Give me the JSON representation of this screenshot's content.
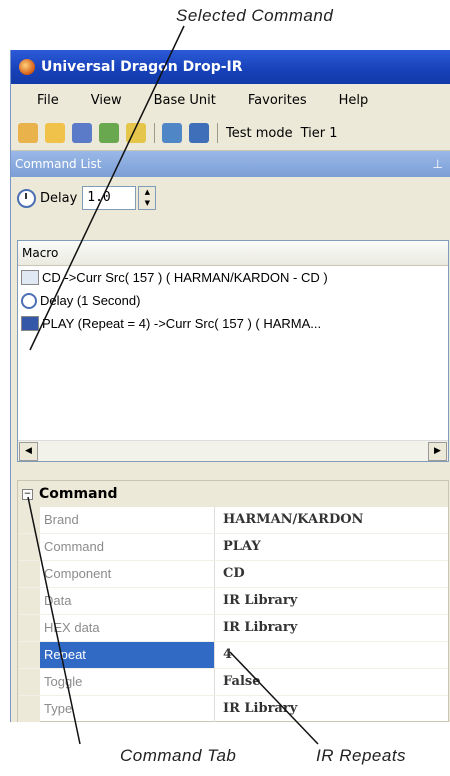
{
  "callouts": {
    "top": "Selected Command",
    "bottom_left": "Command Tab",
    "bottom_right": "IR Repeats"
  },
  "window": {
    "title": "Universal Dragon Drop-IR"
  },
  "menu": [
    "File",
    "View",
    "Base Unit",
    "Favorites",
    "Help"
  ],
  "toolbar": {
    "test_mode": "Test mode",
    "tier": "Tier 1"
  },
  "panel": {
    "title": "Command List",
    "pin": "⊥"
  },
  "delay": {
    "label": "Delay",
    "value": "1.0"
  },
  "macro": {
    "column": "Macro",
    "rows": [
      {
        "icon": "ir-code-icon",
        "text": "CD ->Curr Src( 157 ) ( HARMAN/KARDON - CD )"
      },
      {
        "icon": "clock-icon",
        "text": "Delay (1 Second)"
      },
      {
        "icon": "play-command-icon",
        "text": "PLAY (Repeat = 4) ->Curr Src( 157 ) ( HARMA..."
      }
    ]
  },
  "properties": {
    "category": "Command",
    "rows": [
      {
        "name": "Brand",
        "value": "HARMAN/KARDON"
      },
      {
        "name": "Command",
        "value": "PLAY"
      },
      {
        "name": "Component",
        "value": "CD"
      },
      {
        "name": "Data",
        "value": "IR Library"
      },
      {
        "name": "HEX data",
        "value": "IR Library"
      },
      {
        "name": "Repeat",
        "value": "4"
      },
      {
        "name": "Toggle",
        "value": "False"
      },
      {
        "name": "Type",
        "value": "IR Library"
      }
    ],
    "selected_row": "Repeat"
  }
}
